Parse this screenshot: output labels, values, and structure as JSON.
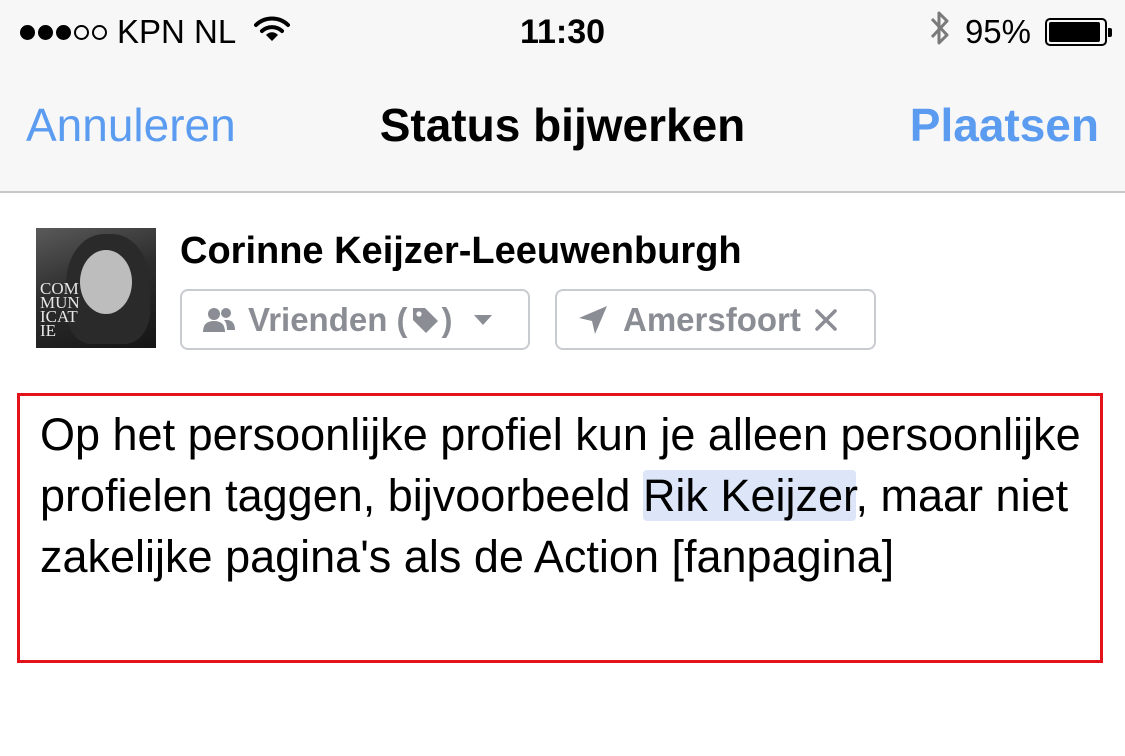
{
  "status_bar": {
    "carrier": "KPN NL",
    "signal_filled": 3,
    "signal_total": 5,
    "time": "11:30",
    "battery": "95%",
    "battery_level": 0.95
  },
  "nav": {
    "cancel_label": "Annuleren",
    "title": "Status bijwerken",
    "post_label": "Plaatsen"
  },
  "composer": {
    "avatar_text": "COM MUN ICAT IE",
    "author_name": "Corinne Keijzer-Leeuwenburgh",
    "audience": {
      "label_start": "Vrienden (",
      "label_end": ")"
    },
    "location": {
      "label": "Amersfoort"
    },
    "post": {
      "text_before": "Op het persoonlijke profiel kun je alleen persoonlijke profielen taggen, bijvoorbeeld ",
      "tagged_name": "Rik Keijzer",
      "text_after": ", maar niet zakelijke pagina's als de Action [fanpagina]"
    }
  },
  "colors": {
    "accent": "#5b9cf1",
    "highlight_border": "#e2131b",
    "tag_background": "#dde6f8",
    "chip_text": "#8a8d93"
  }
}
